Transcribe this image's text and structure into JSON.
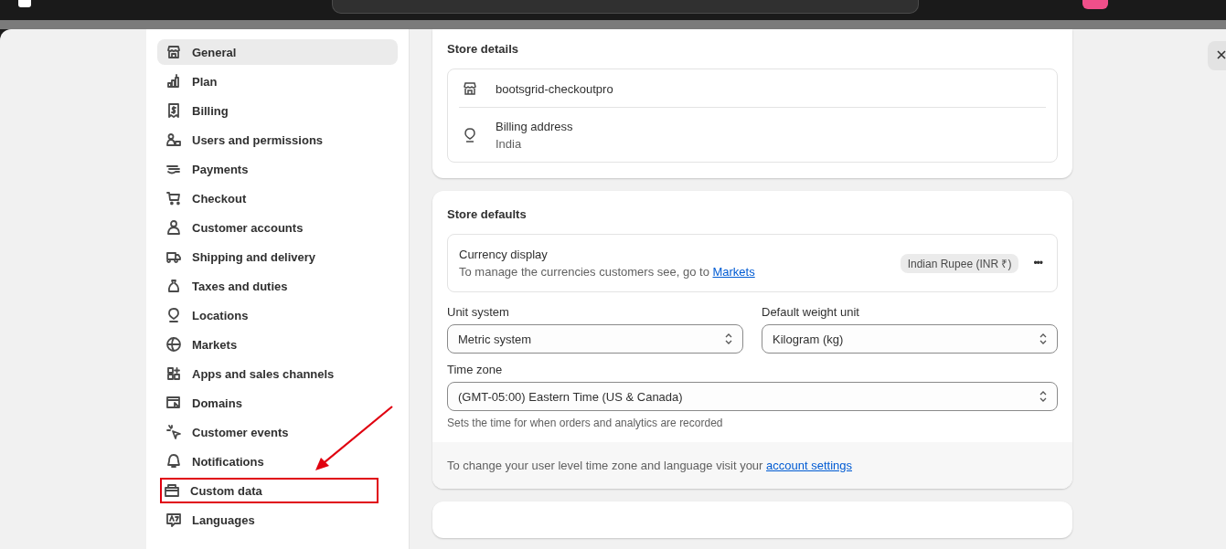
{
  "sidebar": {
    "items": [
      {
        "label": "General",
        "selected": true,
        "annotated": false
      },
      {
        "label": "Plan",
        "selected": false,
        "annotated": false
      },
      {
        "label": "Billing",
        "selected": false,
        "annotated": false
      },
      {
        "label": "Users and permissions",
        "selected": false,
        "annotated": false
      },
      {
        "label": "Payments",
        "selected": false,
        "annotated": false
      },
      {
        "label": "Checkout",
        "selected": false,
        "annotated": false
      },
      {
        "label": "Customer accounts",
        "selected": false,
        "annotated": false
      },
      {
        "label": "Shipping and delivery",
        "selected": false,
        "annotated": false
      },
      {
        "label": "Taxes and duties",
        "selected": false,
        "annotated": false
      },
      {
        "label": "Locations",
        "selected": false,
        "annotated": false
      },
      {
        "label": "Markets",
        "selected": false,
        "annotated": false
      },
      {
        "label": "Apps and sales channels",
        "selected": false,
        "annotated": false
      },
      {
        "label": "Domains",
        "selected": false,
        "annotated": false
      },
      {
        "label": "Customer events",
        "selected": false,
        "annotated": false
      },
      {
        "label": "Notifications",
        "selected": false,
        "annotated": false
      },
      {
        "label": "Custom data",
        "selected": false,
        "annotated": true
      },
      {
        "label": "Languages",
        "selected": false,
        "annotated": false
      }
    ]
  },
  "store_details": {
    "title": "Store details",
    "store_name": "bootsgrid-checkoutpro",
    "billing_label": "Billing address",
    "billing_value": "India"
  },
  "store_defaults": {
    "title": "Store defaults",
    "currency_title": "Currency display",
    "currency_text": "To manage the currencies customers see, go to ",
    "currency_link": "Markets",
    "currency_badge": "Indian Rupee (INR ₹)",
    "more": "•••",
    "unit_label": "Unit system",
    "unit_value": "Metric system",
    "weight_label": "Default weight unit",
    "weight_value": "Kilogram (kg)",
    "timezone_label": "Time zone",
    "timezone_value": "(GMT-05:00) Eastern Time (US & Canada)",
    "timezone_help": "Sets the time for when orders and analytics are recorded",
    "footer_text": "To change your user level time zone and language visit your ",
    "footer_link": "account settings"
  }
}
